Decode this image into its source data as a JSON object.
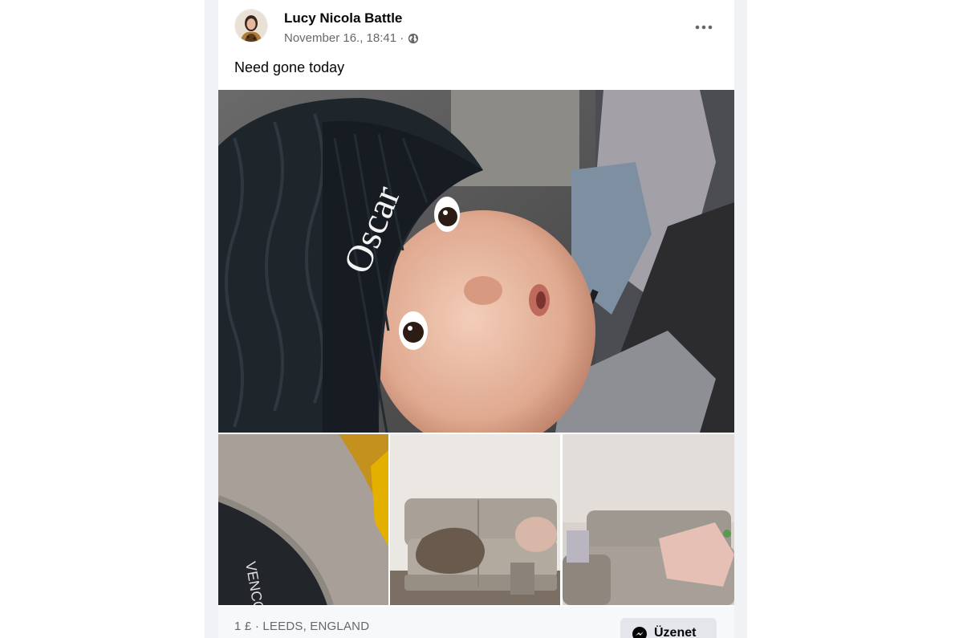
{
  "post": {
    "author": "Lucy Nicola Battle",
    "timestamp": "November 16., 18:41 ·",
    "privacy_icon": "globe-icon",
    "text": "Need gone today"
  },
  "photos": {
    "main": {
      "hat_text": "Oscar"
    },
    "thumb1": {
      "brand_text": "VENCO"
    }
  },
  "listing": {
    "price_location": "1 £ · LEEDS, ENGLAND",
    "message_label": "Üzenet"
  },
  "colors": {
    "feed_bg": "#f0f2f5",
    "secondary_text": "#65676b",
    "button_bg": "#e4e6eb"
  }
}
